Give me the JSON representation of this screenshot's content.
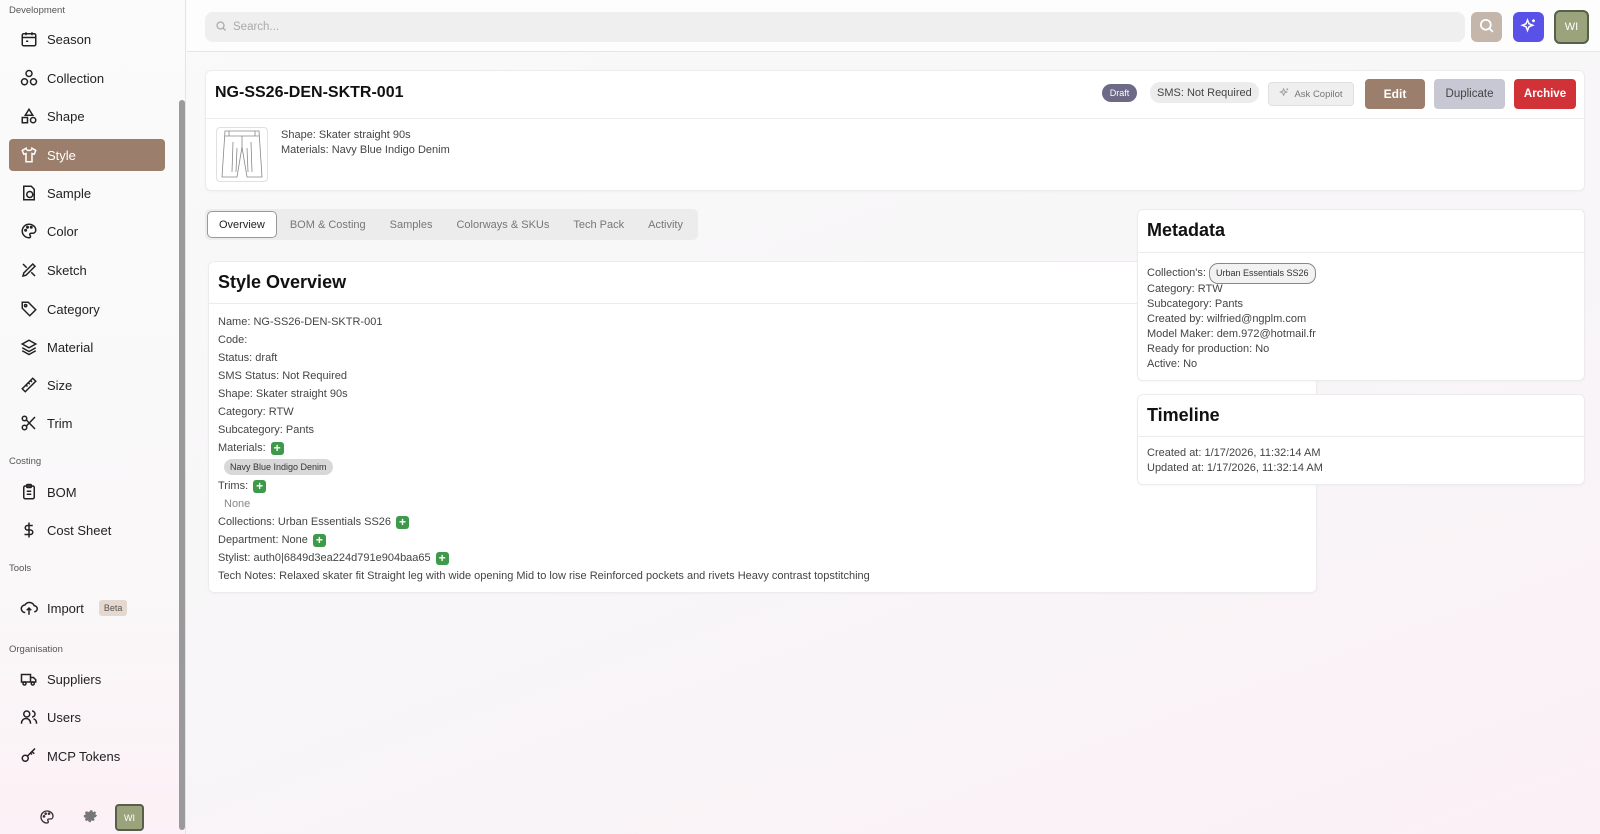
{
  "sidebar": {
    "sections": {
      "development": "Development",
      "costing": "Costing",
      "tools": "Tools",
      "organisation": "Organisation"
    },
    "items": [
      {
        "label": "Season",
        "icon": "calendar-icon"
      },
      {
        "label": "Collection",
        "icon": "collection-icon"
      },
      {
        "label": "Shape",
        "icon": "shapes-icon"
      },
      {
        "label": "Style",
        "icon": "shirt-icon",
        "active": true
      },
      {
        "label": "Sample",
        "icon": "sample-icon"
      },
      {
        "label": "Color",
        "icon": "palette-icon"
      },
      {
        "label": "Sketch",
        "icon": "sketch-icon"
      },
      {
        "label": "Category",
        "icon": "tag-icon"
      },
      {
        "label": "Material",
        "icon": "layers-icon"
      },
      {
        "label": "Size",
        "icon": "ruler-icon"
      },
      {
        "label": "Trim",
        "icon": "scissors-icon"
      },
      {
        "label": "BOM",
        "icon": "clipboard-icon"
      },
      {
        "label": "Cost Sheet",
        "icon": "dollar-icon"
      },
      {
        "label": "Import",
        "icon": "upload-cloud-icon",
        "badge": "Beta"
      },
      {
        "label": "Suppliers",
        "icon": "truck-icon"
      },
      {
        "label": "Users",
        "icon": "users-icon"
      },
      {
        "label": "MCP Tokens",
        "icon": "key-icon"
      }
    ],
    "user_initials": "WI"
  },
  "header": {
    "search_placeholder": "Search...",
    "user_initials": "WI"
  },
  "style": {
    "code": "NG-SS26-DEN-SKTR-001",
    "status_badge": "Draft",
    "sms_badge": "SMS: Not Required",
    "shape_line": "Shape: Skater straight 90s",
    "materials_line": "Materials: Navy Blue Indigo Denim"
  },
  "actions": {
    "ask_copilot": "Ask Copilot",
    "edit": "Edit",
    "duplicate": "Duplicate",
    "archive": "Archive"
  },
  "tabs": [
    "Overview",
    "BOM & Costing",
    "Samples",
    "Colorways & SKUs",
    "Tech Pack",
    "Activity"
  ],
  "overview": {
    "title": "Style Overview",
    "name": "Name: NG-SS26-DEN-SKTR-001",
    "code": "Code:",
    "status": "Status: draft",
    "sms_status": "SMS Status: Not Required",
    "shape": "Shape: Skater straight 90s",
    "category": "Category: RTW",
    "subcategory": "Subcategory: Pants",
    "materials_label": "Materials:",
    "material_chip": "Navy Blue Indigo Denim",
    "trims_label": "Trims:",
    "trims_value": "None",
    "collections": "Collections: Urban Essentials SS26",
    "department": "Department: None",
    "stylist": "Stylist: auth0|6849d3ea224d791e904baa65",
    "tech_notes": "Tech Notes: Relaxed skater fit Straight leg with wide opening Mid to low rise Reinforced pockets and rivets Heavy contrast topstitching"
  },
  "metadata": {
    "title": "Metadata",
    "collections_label": "Collection's:",
    "collection_chip": "Urban Essentials SS26",
    "category": "Category: RTW",
    "subcategory": "Subcategory: Pants",
    "created_by": "Created by: wilfried@ngplm.com",
    "model_maker": "Model Maker: dem.972@hotmail.fr",
    "ready": "Ready for production: No",
    "active": "Active: No"
  },
  "timeline": {
    "title": "Timeline",
    "created": "Created at: 1/17/2026, 11:32:14 AM",
    "updated": "Updated at: 1/17/2026, 11:32:14 AM"
  },
  "colors": {
    "accent": "#9b7f6c",
    "archive": "#d13238",
    "ai": "#5a52e8",
    "plus": "#3e9a4a"
  }
}
